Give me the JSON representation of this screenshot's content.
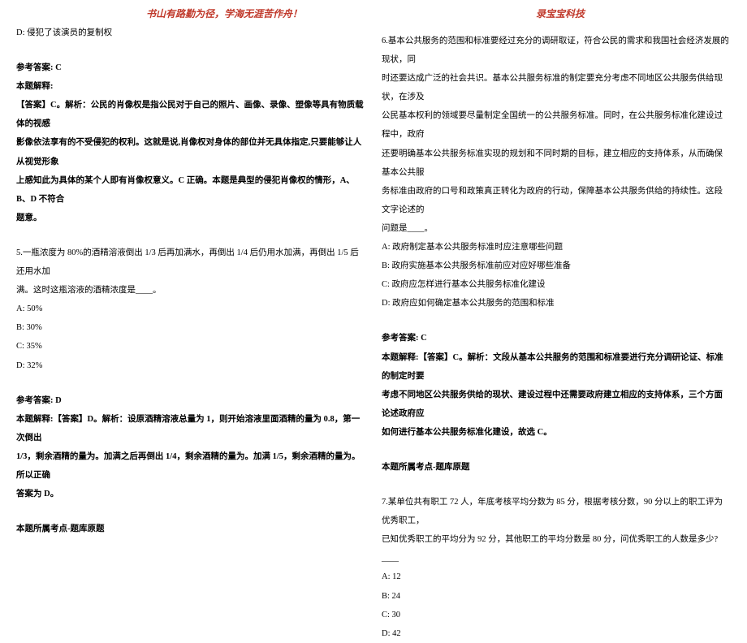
{
  "header": {
    "left": "书山有路勤为径，学海无涯苦作舟！",
    "right": "录宝宝科技"
  },
  "left_col": {
    "q4_optD": "D: 侵犯了该演员的复制权",
    "q4_answer_label": "参考答案: C",
    "q4_explain_title": "本题解释:",
    "q4_explain_p1": "【答案】C。解析：公民的肖像权是指公民对于自己的照片、画像、录像、塑像等具有物质载体的视感",
    "q4_explain_p2": "影像依法享有的不受侵犯的权利。这就是说,肖像权对身体的部位并无具体指定,只要能够让人从视觉形象",
    "q4_explain_p3": "上感知此为具体的某个人即有肖像权意义。C 正确。本题是典型的侵犯肖像权的情形，A、B、D 不符合",
    "q4_explain_p4": "题意。",
    "q5_stem1": "5.一瓶浓度为 80%的酒精溶液倒出 1/3 后再加满水，再倒出 1/4 后仍用水加满，再倒出 1/5 后还用水加",
    "q5_stem2": "满。这时这瓶溶液的酒精浓度是____。",
    "q5_A": "A: 50%",
    "q5_B": "B: 30%",
    "q5_C": "C: 35%",
    "q5_D": "D: 32%",
    "q5_answer_label": "参考答案: D",
    "q5_explain_p1": "本题解释:【答案】D。解析：设原酒精溶液总量为 1，则开始溶液里面酒精的量为 0.8，第一次倒出",
    "q5_explain_p2": "1/3，剩余酒精的量为。加满之后再倒出 1/4，剩余酒精的量为。加满 1/5，剩余酒精的量为。所以正确",
    "q5_explain_p3": "答案为 D。",
    "q5_topic": "本题所属考点-题库原题"
  },
  "right_col": {
    "q6_p1": "6.基本公共服务的范围和标准要经过充分的调研取证，符合公民的需求和我国社会经济发展的现状，同",
    "q6_p2": "时还要达成广泛的社会共识。基本公共服务标准的制定要充分考虑不同地区公共服务供给现状，在涉及",
    "q6_p3": "公民基本权利的领域要尽量制定全国统一的公共服务标准。同时，在公共服务标准化建设过程中，政府",
    "q6_p4": "还要明确基本公共服务标准实现的规划和不同时期的目标，建立相应的支持体系，从而确保基本公共服",
    "q6_p5": "务标准由政府的口号和政策真正转化为政府的行动，保障基本公共服务供给的持续性。这段文字论述的",
    "q6_p6": "问题是____。",
    "q6_A": "A: 政府制定基本公共服务标准时应注意哪些问题",
    "q6_B": "B: 政府实施基本公共服务标准前应对应好哪些准备",
    "q6_C": "C: 政府应怎样进行基本公共服务标准化建设",
    "q6_D": "D: 政府应如何确定基本公共服务的范围和标准",
    "q6_answer_label": "参考答案: C",
    "q6_explain_p1": "本题解释:【答案】C。解析：文段从基本公共服务的范围和标准要进行充分调研论证、标准的制定时要",
    "q6_explain_p2": "考虑不同地区公共服务供给的现状、建设过程中还需要政府建立相应的支持体系，三个方面论述政府应",
    "q6_explain_p3": "如何进行基本公共服务标准化建设，故选 C。",
    "q6_topic": "本题所属考点-题库原题",
    "q7_p1": "7.某单位共有职工 72 人，年底考核平均分数为 85 分，根据考核分数，90 分以上的职工评为优秀职工，",
    "q7_p2": "已知优秀职工的平均分为 92 分，其他职工的平均分数是 80 分，问优秀职工的人数是多少?____",
    "q7_A": "A: 12",
    "q7_B": "B: 24",
    "q7_C": "C: 30",
    "q7_D": "D: 42"
  }
}
